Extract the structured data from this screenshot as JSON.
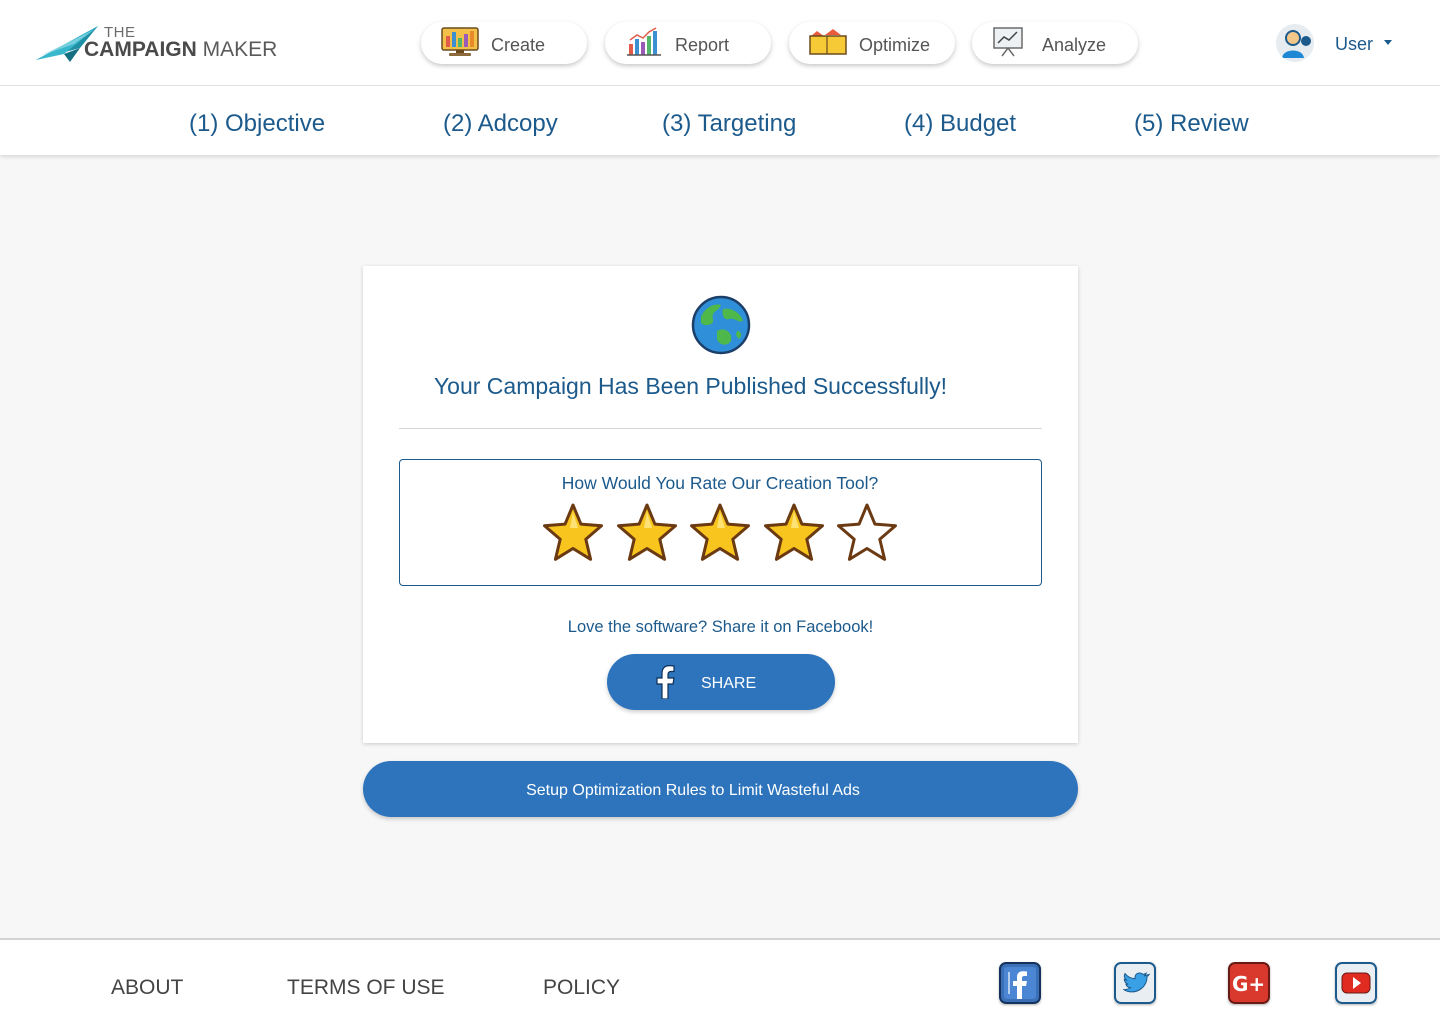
{
  "brand": {
    "the": "THE",
    "campaign": "CAMPAIGN",
    "maker": "MAKER"
  },
  "nav": [
    {
      "label": "Create",
      "icon": "monitor-chart-icon"
    },
    {
      "label": "Report",
      "icon": "bar-chart-icon"
    },
    {
      "label": "Optimize",
      "icon": "folders-icon"
    },
    {
      "label": "Analyze",
      "icon": "presentation-chart-icon"
    }
  ],
  "user": {
    "name": "User"
  },
  "steps": [
    "(1) Objective",
    "(2) Adcopy",
    "(3) Targeting",
    "(4) Budget",
    "(5) Review"
  ],
  "card": {
    "title": "Your Campaign Has Been Published Successfully!",
    "rating_question": "How Would You Rate Our Creation Tool?",
    "rating": {
      "value": 4,
      "max": 5
    },
    "share_prompt": "Love the software? Share it on Facebook!",
    "share_label": "SHARE"
  },
  "optimize_button": "Setup Optimization Rules to Limit Wasteful Ads",
  "footer": {
    "links": [
      "ABOUT",
      "TERMS OF USE",
      "POLICY"
    ],
    "social": [
      "facebook-icon",
      "twitter-icon",
      "google-plus-icon",
      "youtube-icon"
    ]
  },
  "colors": {
    "primary": "#2d74bd",
    "text": "#1c5a8c",
    "star": "#f7c51e",
    "star_outline": "#6b3a12"
  }
}
